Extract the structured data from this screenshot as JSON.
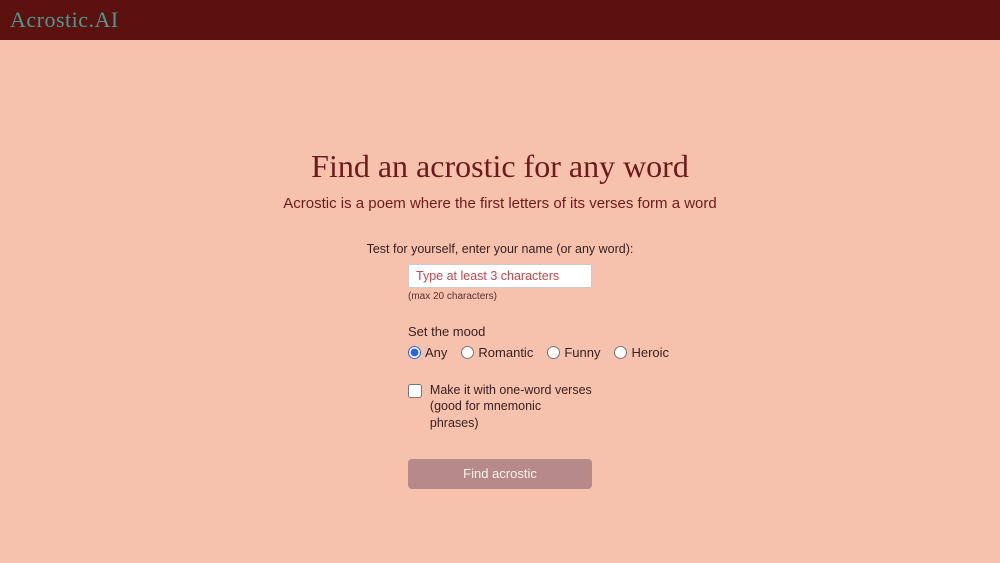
{
  "header": {
    "logo": "Acrostic.AI"
  },
  "main": {
    "title": "Find an acrostic for any word",
    "subtitle": "Acrostic is a poem where the first letters of its verses form a word",
    "form": {
      "input_label": "Test for yourself, enter your name (or any word):",
      "input_placeholder": "Type at least 3 characters",
      "max_chars_note": "(max 20 characters)",
      "mood_label": "Set the mood",
      "moods": [
        {
          "value": "any",
          "label": "Any",
          "checked": true
        },
        {
          "value": "romantic",
          "label": "Romantic",
          "checked": false
        },
        {
          "value": "funny",
          "label": "Funny",
          "checked": false
        },
        {
          "value": "heroic",
          "label": "Heroic",
          "checked": false
        }
      ],
      "checkbox_label_line1": "Make it with one-word verses",
      "checkbox_label_line2": "(good for mnemonic phrases)",
      "submit_label": "Find acrostic"
    }
  }
}
